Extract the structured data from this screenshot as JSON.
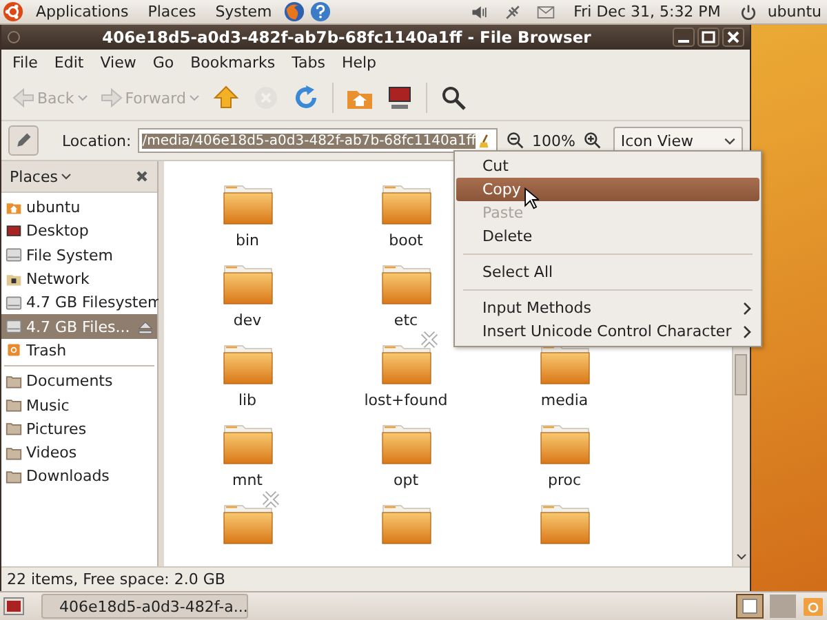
{
  "top_panel": {
    "menus": [
      "Applications",
      "Places",
      "System"
    ],
    "clock": "Fri Dec 31,  5:32 PM",
    "user": "ubuntu"
  },
  "window": {
    "title": "406e18d5-a0d3-482f-ab7b-68fc1140a1ff - File Browser"
  },
  "menubar": [
    "File",
    "Edit",
    "View",
    "Go",
    "Bookmarks",
    "Tabs",
    "Help"
  ],
  "toolbar": [
    {
      "kind": "back",
      "label": "Back",
      "disabled": true
    },
    {
      "kind": "forward",
      "label": "Forward",
      "disabled": true
    },
    {
      "kind": "up",
      "disabled": false
    },
    {
      "kind": "stop",
      "disabled": true
    },
    {
      "kind": "reload",
      "disabled": false
    },
    {
      "kind": "home",
      "disabled": false
    },
    {
      "kind": "computer",
      "disabled": false
    },
    {
      "kind": "search",
      "disabled": false
    }
  ],
  "location": {
    "label": "Location:",
    "value": "/media/406e18d5-a0d3-482f-ab7b-68fc1140a1ff",
    "zoom": "100%",
    "view": "Icon View"
  },
  "sidebar": {
    "title": "Places",
    "groups": [
      [
        {
          "label": "ubuntu",
          "kind": "home",
          "selected": false
        },
        {
          "label": "Desktop",
          "kind": "desktop",
          "selected": false
        },
        {
          "label": "File System",
          "kind": "drive",
          "selected": false
        },
        {
          "label": "Network",
          "kind": "network",
          "selected": false
        },
        {
          "label": "4.7 GB Filesystem",
          "kind": "drive",
          "selected": false
        },
        {
          "label": "4.7 GB Files...",
          "kind": "drive",
          "selected": true,
          "eject": true
        },
        {
          "label": "Trash",
          "kind": "trash",
          "selected": false
        }
      ],
      [
        {
          "label": "Documents",
          "kind": "folder",
          "selected": false
        },
        {
          "label": "Music",
          "kind": "folder",
          "selected": false
        },
        {
          "label": "Pictures",
          "kind": "folder",
          "selected": false
        },
        {
          "label": "Videos",
          "kind": "folder",
          "selected": false
        },
        {
          "label": "Downloads",
          "kind": "folder",
          "selected": false
        }
      ]
    ]
  },
  "icon_rows": [
    [
      {
        "label": "bin",
        "unreadable": false
      },
      {
        "label": "boot",
        "unreadable": false
      }
    ],
    [
      {
        "label": "dev",
        "unreadable": false
      },
      {
        "label": "etc",
        "unreadable": false
      }
    ],
    [
      {
        "label": "lib",
        "unreadable": false
      },
      {
        "label": "lost+found",
        "unreadable": true
      },
      {
        "label": "media",
        "unreadable": false
      }
    ],
    [
      {
        "label": "mnt",
        "unreadable": false
      },
      {
        "label": "opt",
        "unreadable": false
      },
      {
        "label": "proc",
        "unreadable": false
      }
    ],
    [
      {
        "unreadable": true
      },
      {
        "unreadable": false
      },
      {
        "unreadable": false
      }
    ]
  ],
  "context_menu": [
    {
      "kind": "item",
      "label": "Cut",
      "selected": false,
      "disabled": false
    },
    {
      "kind": "item",
      "label": "Copy",
      "selected": true,
      "disabled": false
    },
    {
      "kind": "item",
      "label": "Paste",
      "selected": false,
      "disabled": true
    },
    {
      "kind": "item",
      "label": "Delete",
      "selected": false,
      "disabled": false
    },
    {
      "kind": "separator"
    },
    {
      "kind": "item",
      "label": "Select All",
      "selected": false,
      "disabled": false
    },
    {
      "kind": "separator"
    },
    {
      "kind": "item",
      "label": "Input Methods",
      "selected": false,
      "disabled": false,
      "submenu": true
    },
    {
      "kind": "item",
      "label": "Insert Unicode Control Character",
      "selected": false,
      "disabled": false,
      "submenu": true
    }
  ],
  "status_bar": "22 items, Free space: 2.0 GB",
  "taskbar": [
    {
      "label": "406e18d5-a0d3-482f-a..."
    }
  ]
}
